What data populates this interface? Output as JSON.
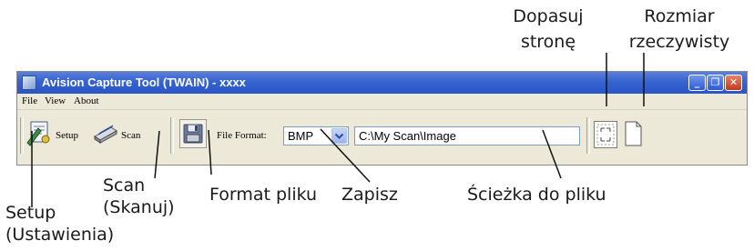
{
  "window": {
    "title": "Avision Capture Tool (TWAIN) -  xxxx",
    "controls": {
      "minimize": "_",
      "maximize": "❐",
      "close": "✕"
    }
  },
  "menu": {
    "items": [
      "File",
      "View",
      "About"
    ]
  },
  "toolbar": {
    "setup_label": "Setup",
    "scan_label": "Scan",
    "file_format_label": "File Format:",
    "file_format_value": "BMP",
    "path_value": "C:\\My Scan\\Image"
  },
  "callouts": {
    "fit_page": [
      "Dopasuj",
      "stronę"
    ],
    "actual_size": [
      "Rozmiar",
      "rzeczywisty"
    ],
    "scan": [
      "Scan",
      "(Skanuj)"
    ],
    "file_format": "Format pliku",
    "save": "Zapisz",
    "file_path": "Ścieżka do pliku",
    "setup": [
      "Setup",
      "(Ustawienia)"
    ]
  },
  "colors": {
    "titlebar": "#2a56c6",
    "close_button": "#c4391d",
    "toolbar_bg": "#ece9d8"
  },
  "icons": {
    "app": "app-icon",
    "setup": "setup-icon",
    "scan": "scanner-icon",
    "save": "floppy-disk-icon",
    "dropdown": "chevron-down-icon",
    "fit_page": "fit-page-icon",
    "actual_size": "actual-size-icon"
  }
}
